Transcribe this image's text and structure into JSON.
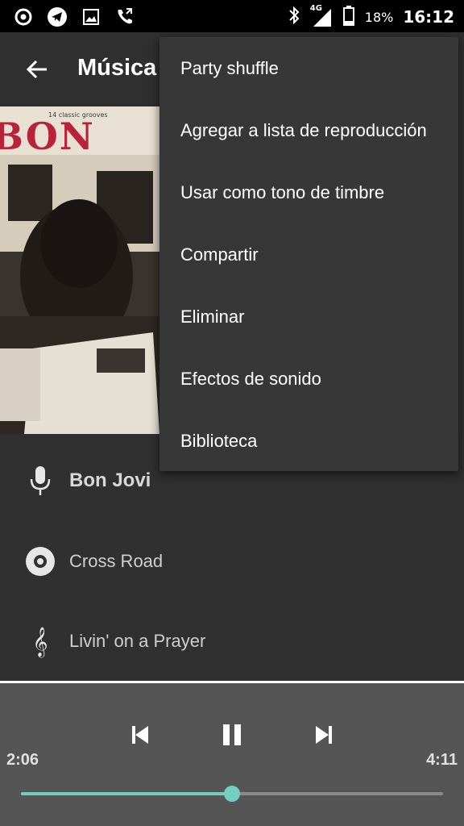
{
  "status_bar": {
    "network": "4G",
    "battery": "18%",
    "time": "16:12",
    "icons_left": [
      "circle-dot-icon",
      "telegram-icon",
      "image-icon",
      "phone-call-icon"
    ],
    "icons_right": [
      "bluetooth-icon",
      "signal-icon",
      "battery-icon"
    ]
  },
  "toolbar": {
    "title": "Música",
    "back_icon": "arrow-left-icon"
  },
  "album": {
    "art_text_top": "14 classic grooves",
    "art_text_main": "BON"
  },
  "track_info": {
    "artist": "Bon Jovi",
    "album": "Cross Road",
    "title": "Livin' on a Prayer"
  },
  "player": {
    "elapsed": "2:06",
    "duration": "4:11",
    "progress": 0.5,
    "controls": [
      "skip-previous-icon",
      "pause-icon",
      "skip-next-icon"
    ],
    "accent": "#73cfc2"
  },
  "menu": {
    "items": [
      "Party shuffle",
      "Agregar a lista de reproducción",
      "Usar como tono de timbre",
      "Compartir",
      "Eliminar",
      "Efectos de sonido",
      "Biblioteca"
    ]
  }
}
